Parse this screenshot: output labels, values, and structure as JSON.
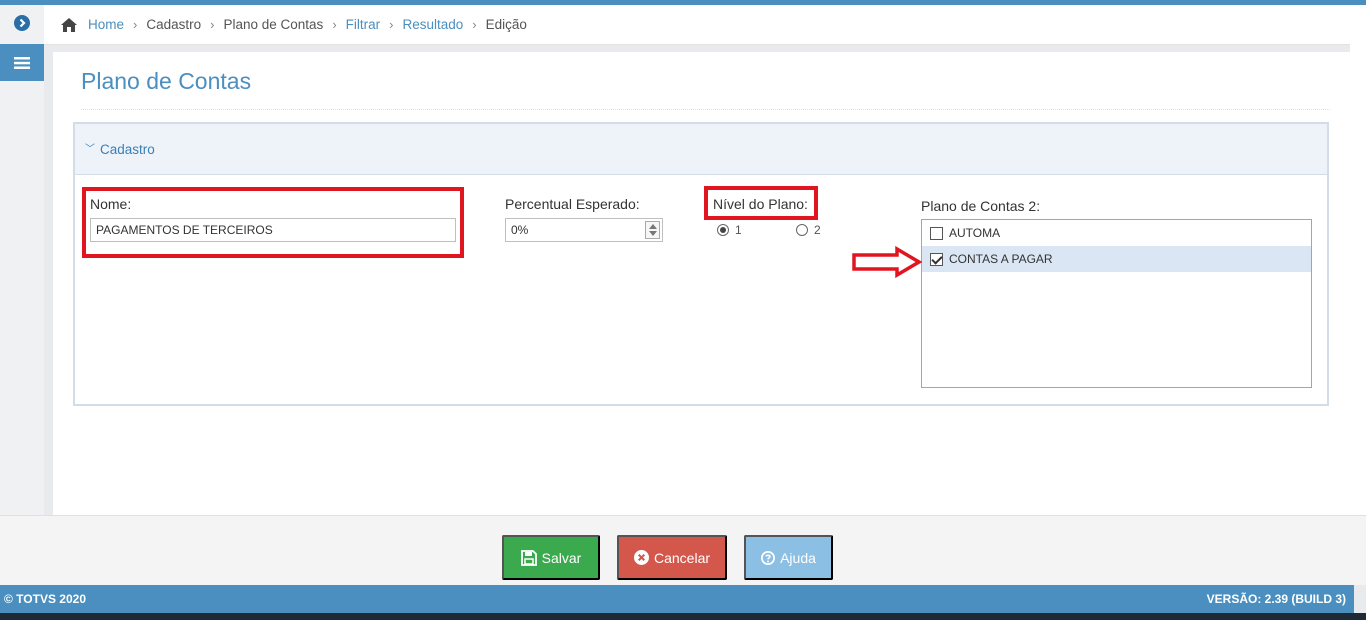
{
  "breadcrumb": {
    "items": [
      {
        "label": "Home",
        "link": true
      },
      {
        "label": "Cadastro",
        "link": false
      },
      {
        "label": "Plano de Contas",
        "link": false
      },
      {
        "label": "Filtrar",
        "link": true
      },
      {
        "label": "Resultado",
        "link": true
      },
      {
        "label": "Edição",
        "link": false
      }
    ]
  },
  "page": {
    "title": "Plano de Contas"
  },
  "panel": {
    "header": "Cadastro"
  },
  "form": {
    "nome_label": "Nome:",
    "nome_value": "PAGAMENTOS DE TERCEIROS",
    "percentual_label": "Percentual Esperado:",
    "percentual_value": "0%",
    "nivel_label": "Nível do Plano:",
    "nivel_options": [
      {
        "label": "1",
        "selected": true
      },
      {
        "label": "2",
        "selected": false
      }
    ],
    "plano2_label": "Plano de Contas 2:",
    "plano2_items": [
      {
        "label": "AUTOMA",
        "checked": false
      },
      {
        "label": "CONTAS A PAGAR",
        "checked": true
      }
    ]
  },
  "buttons": {
    "save": "Salvar",
    "cancel": "Cancelar",
    "help": "Ajuda"
  },
  "footer": {
    "copyright": "© TOTVS 2020",
    "version": "VERSÃO: 2.39 (BUILD 3)"
  },
  "icons": {
    "home": "home-icon",
    "toggle": "chevron-right-circle-icon",
    "menu": "hamburger-icon",
    "save": "floppy-disk-icon",
    "cancel": "close-circle-icon",
    "help": "question-circle-icon",
    "arrow": "right-arrow-annotation-icon"
  },
  "colors": {
    "primary": "#4a8fbf",
    "annotation": "#e0151f",
    "save": "#3ba94e",
    "cancel": "#d4574b",
    "help": "#8cbfe4"
  }
}
